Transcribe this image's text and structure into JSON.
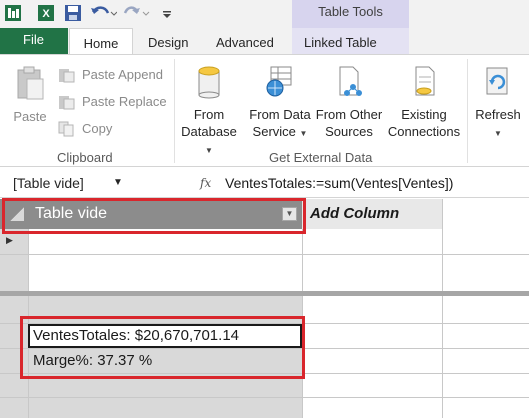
{
  "title_bar": {
    "context_group": "Table Tools",
    "quick_access": [
      "powerpivot-icon",
      "excel-icon",
      "save-icon",
      "undo-icon",
      "redo-icon",
      "customize-icon"
    ]
  },
  "tabs": {
    "file": "File",
    "home": "Home",
    "design": "Design",
    "advanced": "Advanced",
    "linked_table": "Linked Table"
  },
  "ribbon": {
    "clipboard": {
      "label": "Clipboard",
      "paste": "Paste",
      "paste_append": "Paste Append",
      "paste_replace": "Paste Replace",
      "copy": "Copy"
    },
    "external": {
      "label": "Get External Data",
      "from_database_1": "From",
      "from_database_2": "Database",
      "from_data_service_1": "From Data",
      "from_data_service_2": "Service",
      "from_other_sources_1": "From Other",
      "from_other_sources_2": "Sources",
      "existing_connections_1": "Existing",
      "existing_connections_2": "Connections"
    },
    "refresh": "Refresh"
  },
  "formula_bar": {
    "name_box": "[Table vide]",
    "fx": "fx",
    "formula": "VentesTotales:=sum(Ventes[Ventes])"
  },
  "grid": {
    "column_header": "Table vide",
    "add_column": "Add Column",
    "measures": [
      "VentesTotales: $20,670,701.14",
      "Marge%: 37.37 %"
    ]
  },
  "colors": {
    "file_tab": "#217346",
    "table_tools": "#d7d4ee",
    "highlight": "#d9262c",
    "column_header": "#8c8c8c"
  }
}
